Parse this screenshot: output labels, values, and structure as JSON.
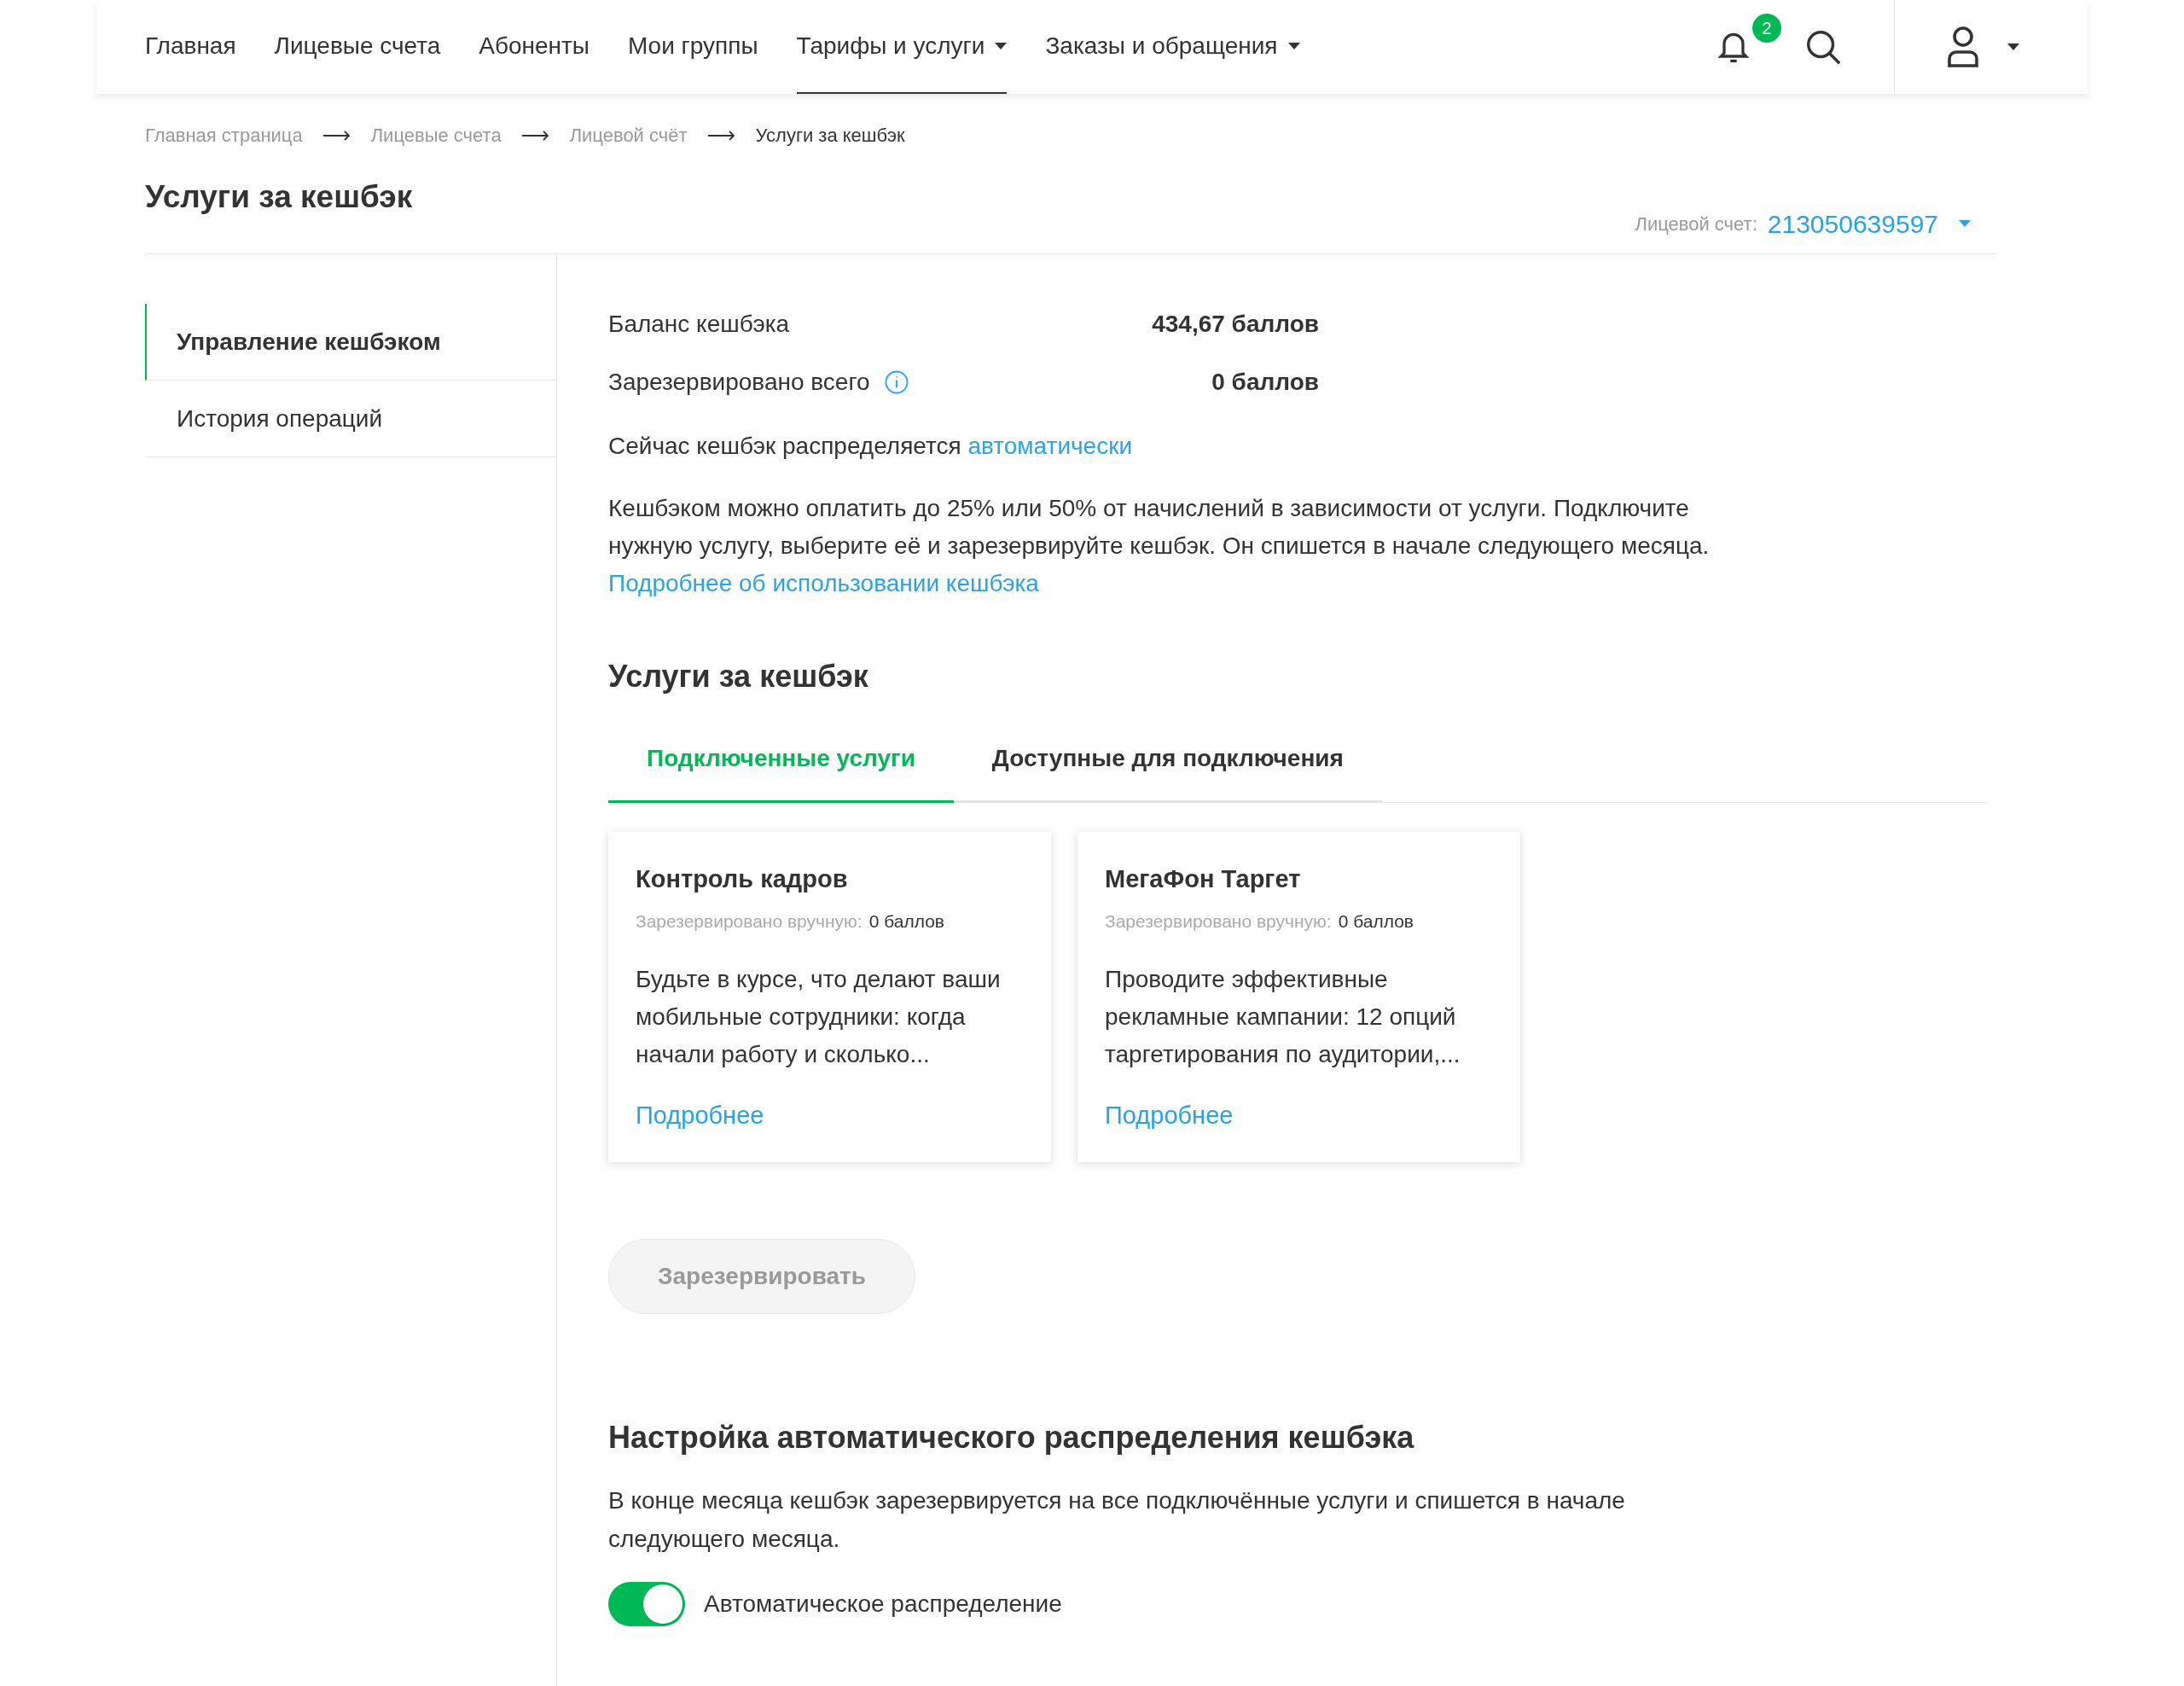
{
  "nav": {
    "items": [
      {
        "label": "Главная",
        "selected": false,
        "dropdown": false
      },
      {
        "label": "Лицевые счета",
        "selected": false,
        "dropdown": false
      },
      {
        "label": "Абоненты",
        "selected": false,
        "dropdown": false
      },
      {
        "label": "Мои группы",
        "selected": false,
        "dropdown": false
      },
      {
        "label": "Тарифы и услуги",
        "selected": true,
        "dropdown": true
      },
      {
        "label": "Заказы и обращения",
        "selected": false,
        "dropdown": true
      }
    ],
    "notifications_badge": "2"
  },
  "breadcrumb": [
    "Главная страница",
    "Лицевые счета",
    "Лицевой счёт",
    "Услуги за кешбэк"
  ],
  "page_title": "Услуги за кешбэк",
  "account": {
    "label": "Лицевой счет:",
    "value": "213050639597"
  },
  "sidebar": {
    "items": [
      {
        "label": "Управление кешбэком",
        "selected": true
      },
      {
        "label": "История операций",
        "selected": false
      }
    ]
  },
  "summary": [
    {
      "label": "Баланс кешбэка",
      "value": "434,67 баллов",
      "info": false
    },
    {
      "label": "Зарезервировано всего",
      "value": "0 баллов",
      "info": true
    }
  ],
  "mode_text": "Сейчас кешбэк распределяется",
  "mode_link": "автоматически",
  "description": "Кешбэком можно оплатить до 25% или 50% от начислений в зависимости от услуги. Подключите нужную услугу, выберите её и зарезервируйте кешбэк. Он спишется в начале следующего месяца.",
  "description_link": "Подробнее об использовании кешбэка",
  "services": {
    "title": "Услуги за кешбэк",
    "tabs": [
      {
        "label": "Подключенные услуги",
        "selected": true
      },
      {
        "label": "Доступные для подключения",
        "selected": false
      }
    ],
    "cards": [
      {
        "title": "Контроль кадров",
        "reserved_label": "Зарезервировано вручную:",
        "reserved_value": "0 баллов",
        "text": "Будьте в курсе, что делают ваши мобильные сотрудники: когда начали работу и сколько...",
        "link": "Подробнее"
      },
      {
        "title": "МегаФон Таргет",
        "reserved_label": "Зарезервировано вручную:",
        "reserved_value": "0 баллов",
        "text": "Проводите эффективные рекламные кампании: 12 опций таргетирования по аудитории,...",
        "link": "Подробнее"
      }
    ],
    "reserve_button": {
      "label": "Зарезервировать",
      "disabled": true
    }
  },
  "auto": {
    "title": "Настройка автоматического распределения кешбэка",
    "text": "В конце месяца кешбэк зарезервируется на все подключённые услуги и спишется в начале следующего месяца.",
    "toggle": {
      "label": "Автоматическое распределение",
      "on": true
    }
  }
}
